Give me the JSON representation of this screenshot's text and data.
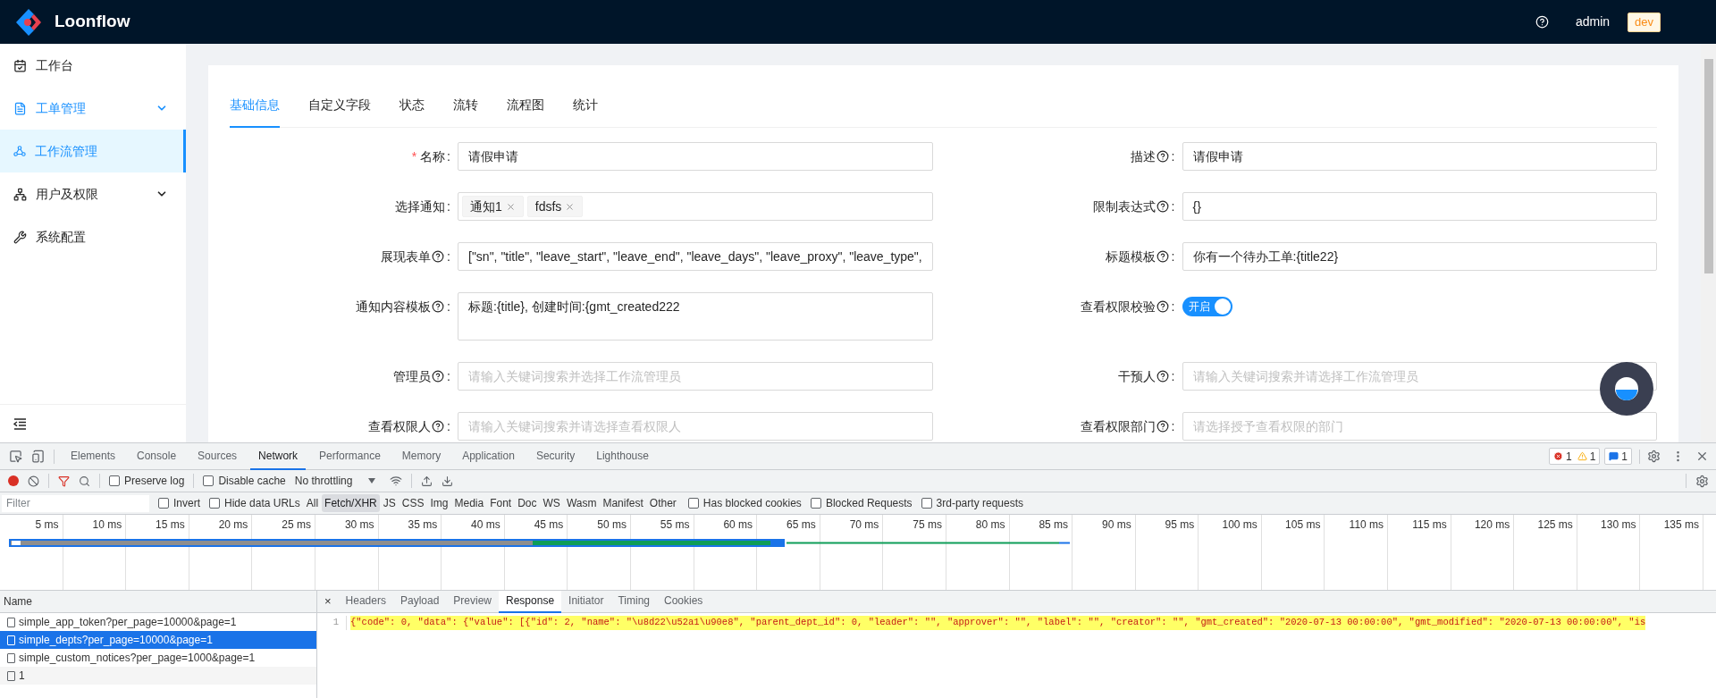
{
  "header": {
    "logo": "Loonflow",
    "user": "admin",
    "env": "dev"
  },
  "sidebar": {
    "items": [
      {
        "label": "工作台",
        "selected": false,
        "active": false,
        "submenu": false
      },
      {
        "label": "工单管理",
        "selected": false,
        "active": true,
        "submenu": true
      },
      {
        "label": "工作流管理",
        "selected": true,
        "active": true,
        "submenu": false
      },
      {
        "label": "用户及权限",
        "selected": false,
        "active": false,
        "submenu": true
      },
      {
        "label": "系统配置",
        "selected": false,
        "active": false,
        "submenu": false
      }
    ]
  },
  "tabs": [
    {
      "label": "基础信息",
      "selected": true
    },
    {
      "label": "自定义字段",
      "selected": false
    },
    {
      "label": "状态",
      "selected": false
    },
    {
      "label": "流转",
      "selected": false
    },
    {
      "label": "流程图",
      "selected": false
    },
    {
      "label": "统计",
      "selected": false
    }
  ],
  "form": {
    "left": [
      {
        "label": "名称",
        "required_mark": "*",
        "help": false,
        "suffix": ":",
        "kind": "input",
        "value": "请假申请"
      },
      {
        "label": "选择通知",
        "help": false,
        "suffix": ":",
        "kind": "tags",
        "tags": [
          {
            "label": "通知1"
          },
          {
            "label": "fdsfs"
          }
        ]
      },
      {
        "label": "展现表单",
        "help": true,
        "suffix": ":",
        "kind": "input",
        "value": "[\"sn\", \"title\", \"leave_start\", \"leave_end\", \"leave_days\", \"leave_proxy\",  \"leave_type\","
      },
      {
        "label": "通知内容模板",
        "help": true,
        "suffix": ":",
        "kind": "textarea",
        "value": "标题:{title}, 创建时间:{gmt_created222"
      },
      {
        "label": "管理员",
        "help": true,
        "suffix": ":",
        "kind": "input",
        "placeholder": "请输入关键词搜索并选择工作流管理员"
      },
      {
        "label": "查看权限人",
        "help": true,
        "suffix": ":",
        "kind": "input",
        "placeholder": "请输入关键词搜索并请选择查看权限人"
      }
    ],
    "right": [
      {
        "label": "描述",
        "help": true,
        "suffix": ":",
        "kind": "input",
        "value": "请假申请"
      },
      {
        "label": "限制表达式",
        "help": true,
        "suffix": ":",
        "kind": "input",
        "value": "{}"
      },
      {
        "label": "标题模板",
        "help": true,
        "suffix": ":",
        "kind": "input",
        "value": "你有一个待办工单:{title22}"
      },
      {
        "label": "查看权限校验",
        "help": true,
        "suffix": ":",
        "kind": "switch",
        "on": true,
        "text": "开启"
      },
      {
        "label": "干预人",
        "help": true,
        "suffix": ":",
        "kind": "input",
        "placeholder": "请输入关键词搜索并请选择工作流管理员"
      },
      {
        "label": "查看权限部门",
        "help": true,
        "suffix": ":",
        "kind": "input",
        "placeholder": "请选择授予查看权限的部门"
      }
    ]
  },
  "devtools": {
    "panel_tabs": [
      {
        "label": "Elements",
        "selected": false
      },
      {
        "label": "Console",
        "selected": false
      },
      {
        "label": "Sources",
        "selected": false
      },
      {
        "label": "Network",
        "selected": true
      },
      {
        "label": "Performance",
        "selected": false
      },
      {
        "label": "Memory",
        "selected": false
      },
      {
        "label": "Application",
        "selected": false
      },
      {
        "label": "Security",
        "selected": false
      },
      {
        "label": "Lighthouse",
        "selected": false
      }
    ],
    "counts": {
      "errors": "1",
      "warnings": "1",
      "messages": "1"
    },
    "toolbar": {
      "preserve_log": {
        "label": "Preserve log",
        "checked": false
      },
      "disable_cache": {
        "label": "Disable cache",
        "checked": false
      },
      "throttling": "No throttling"
    },
    "filter": {
      "placeholder": "Filter",
      "invert": {
        "label": "Invert",
        "checked": false
      },
      "hide_data_urls": {
        "label": "Hide data URLs",
        "checked": false
      },
      "types": [
        {
          "label": "All",
          "selected": false
        },
        {
          "label": "Fetch/XHR",
          "selected": true
        },
        {
          "label": "JS",
          "selected": false
        },
        {
          "label": "CSS",
          "selected": false
        },
        {
          "label": "Img",
          "selected": false
        },
        {
          "label": "Media",
          "selected": false
        },
        {
          "label": "Font",
          "selected": false
        },
        {
          "label": "Doc",
          "selected": false
        },
        {
          "label": "WS",
          "selected": false
        },
        {
          "label": "Wasm",
          "selected": false
        },
        {
          "label": "Manifest",
          "selected": false
        },
        {
          "label": "Other",
          "selected": false
        }
      ],
      "options": [
        {
          "label": "Has blocked cookies",
          "checked": false
        },
        {
          "label": "Blocked Requests",
          "checked": false
        },
        {
          "label": "3rd-party requests",
          "checked": false
        }
      ]
    },
    "timeline_ticks": [
      "5 ms",
      "10 ms",
      "15 ms",
      "20 ms",
      "25 ms",
      "30 ms",
      "35 ms",
      "40 ms",
      "45 ms",
      "50 ms",
      "55 ms",
      "60 ms",
      "65 ms",
      "70 ms",
      "75 ms",
      "80 ms",
      "85 ms",
      "90 ms",
      "95 ms",
      "100 ms",
      "105 ms",
      "110 ms",
      "115 ms",
      "120 ms",
      "125 ms",
      "130 ms",
      "135 ms"
    ],
    "requests": {
      "column": "Name",
      "rows": [
        {
          "name": "simple_app_token?per_page=10000&page=1",
          "selected": false
        },
        {
          "name": "simple_depts?per_page=10000&page=1",
          "selected": true
        },
        {
          "name": "simple_custom_notices?per_page=1000&page=1",
          "selected": false
        },
        {
          "name": "1",
          "selected": false
        }
      ]
    },
    "detail": {
      "close": "×",
      "tabs": [
        {
          "label": "Headers",
          "selected": false
        },
        {
          "label": "Payload",
          "selected": false
        },
        {
          "label": "Preview",
          "selected": false
        },
        {
          "label": "Response",
          "selected": true
        },
        {
          "label": "Initiator",
          "selected": false
        },
        {
          "label": "Timing",
          "selected": false
        },
        {
          "label": "Cookies",
          "selected": false
        }
      ],
      "line_number": "1",
      "response": "{\"code\": 0, \"data\": {\"value\": [{\"id\": 2, \"name\": \"\\u8d22\\u52a1\\u90e8\", \"parent_dept_id\": 0, \"leader\": \"\", \"approver\": \"\", \"label\": \"\", \"creator\": \"\", \"gmt_created\": \"2020-07-13 00:00:00\", \"gmt_modified\": \"2020-07-13 00:00:00\", \"is"
    }
  }
}
